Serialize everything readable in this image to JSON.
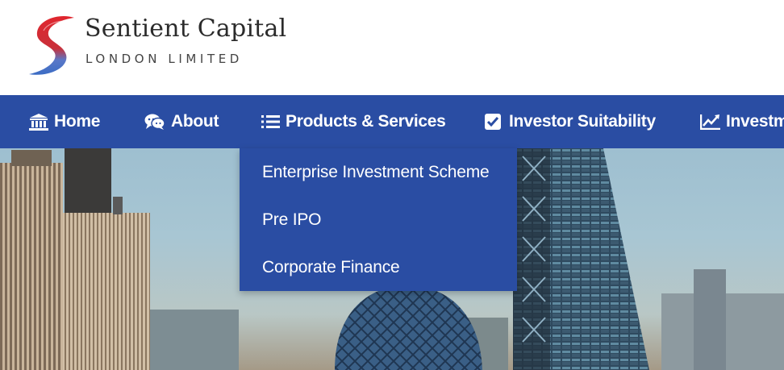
{
  "brand": {
    "name": "Sentient Capital",
    "subtitle": "LONDON LIMITED"
  },
  "nav": {
    "items": [
      {
        "label": "Home",
        "icon": "bank-icon"
      },
      {
        "label": "About",
        "icon": "comments-icon"
      },
      {
        "label": "Products & Services",
        "icon": "list-icon"
      },
      {
        "label": "Investor Suitability",
        "icon": "check-square-icon"
      },
      {
        "label": "Investm",
        "icon": "line-chart-icon"
      }
    ]
  },
  "dropdown": {
    "items": [
      {
        "label": "Enterprise Investment Scheme"
      },
      {
        "label": "Pre IPO"
      },
      {
        "label": "Corporate Finance"
      }
    ]
  },
  "colors": {
    "nav_bg": "#2a4da3",
    "logo_red": "#d8272e",
    "logo_blue": "#3b6cc4"
  }
}
